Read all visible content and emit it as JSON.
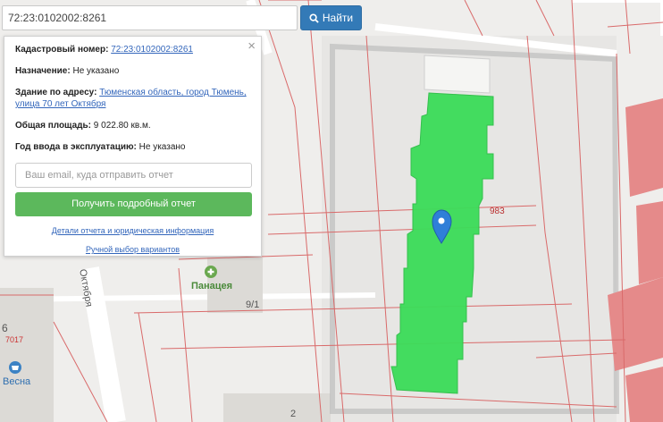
{
  "search": {
    "query": "72:23:0102002:8261",
    "button_label": "Найти"
  },
  "popup": {
    "cadastral_label": "Кадастровый номер:",
    "cadastral_value": "72:23:0102002:8261",
    "purpose_label": "Назначение:",
    "purpose_value": "Не указано",
    "building_label": "Здание по адресу:",
    "building_value": "Тюменская область, город Тюмень, улица 70 лет Октября",
    "area_label": "Общая площадь:",
    "area_value": "9 022.80 кв.м.",
    "year_label": "Год ввода в эксплуатацию:",
    "year_value": "Не указано",
    "email_placeholder": "Ваш email, куда отправить отчет",
    "report_button": "Получить подробный отчет",
    "details_link": "Детали отчета и юридическая информация",
    "manual_link": "Ручной выбор вариантов"
  },
  "map": {
    "parcel_number": "983",
    "building_number": "9/1",
    "street_label": "Октября",
    "pharmacy_name": "Панацея",
    "shop_name": "Весна",
    "house_number": "6",
    "house_number_red": "7017",
    "bottom_label": "2"
  },
  "colors": {
    "primary": "#337ab7",
    "success": "#5cb85c",
    "highlight": "#3ddc5a",
    "pin": "#2f7fd8",
    "cadastre_lines": "#d96a6a"
  }
}
